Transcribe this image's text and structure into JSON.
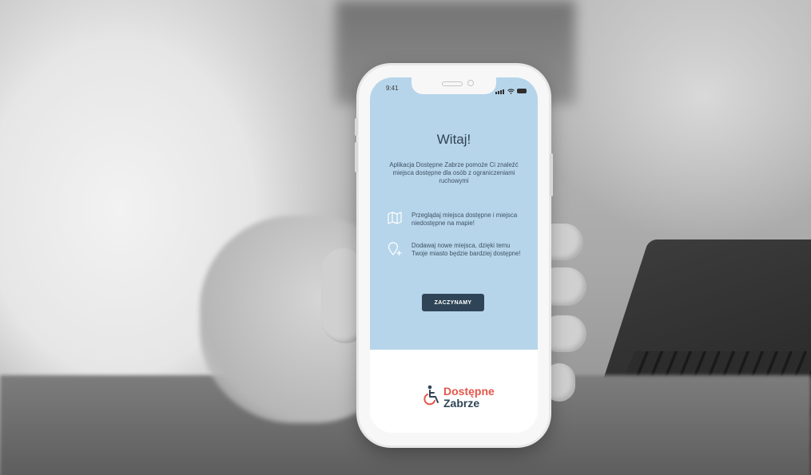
{
  "status_bar": {
    "time": "9:41"
  },
  "welcome": {
    "title": "Witaj!",
    "intro": "Aplikacja Dostępne Zabrze pomoże Ci znaleźć miejsca dostępne dla osób z ograniczeniami ruchowymi"
  },
  "features": [
    {
      "icon": "map-icon",
      "text": "Przeglądaj miejsca dostępne i miejsca niedostępne na mapie!"
    },
    {
      "icon": "add-location-icon",
      "text": "Dodawaj nowe miejsca, dzięki temu Twoje miasto będzie bardziej dostępne!"
    }
  ],
  "cta": {
    "label": "ZACZYNAMY"
  },
  "logo": {
    "line1": "Dostępne",
    "line2": "Zabrze",
    "icon": "wheelchair-icon"
  },
  "colors": {
    "panel": "#b6d5ea",
    "button": "#2f4557",
    "brand_red": "#e4574b",
    "brand_navy": "#2f4557"
  }
}
